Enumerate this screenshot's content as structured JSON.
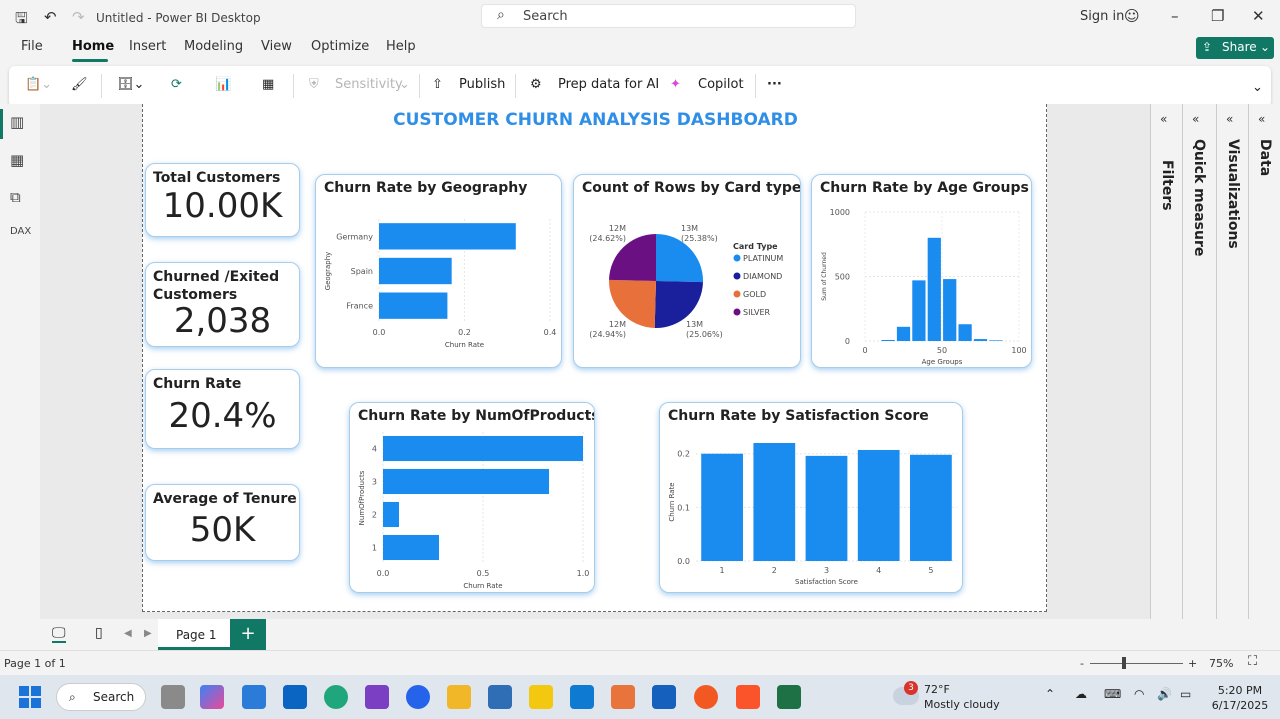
{
  "titlebar": {
    "title": "Untitled - Power BI Desktop",
    "search_placeholder": "Search",
    "signin": "Sign in"
  },
  "menu": {
    "items": [
      "File",
      "Home",
      "Insert",
      "Modeling",
      "View",
      "Optimize",
      "Help"
    ],
    "active": "Home",
    "share": "Share"
  },
  "ribbon": {
    "sensitivity": "Sensitivity",
    "publish": "Publish",
    "prep_ai": "Prep data for AI",
    "copilot": "Copilot",
    "more": "···"
  },
  "report": {
    "title": "CUSTOMER CHURN ANALYSIS DASHBOARD",
    "kpis": [
      {
        "label": "Total Customers",
        "value": "10.00K"
      },
      {
        "label": "Churned /Exited Customers",
        "value": "2,038"
      },
      {
        "label": "Churn Rate",
        "value": "20.4%"
      },
      {
        "label": "Average of Tenure",
        "value": "50K"
      }
    ]
  },
  "chart_data": [
    {
      "id": "geo",
      "type": "bar",
      "orientation": "horizontal",
      "title": "Churn Rate by Geography",
      "categories": [
        "Germany",
        "Spain",
        "France"
      ],
      "values": [
        0.32,
        0.17,
        0.16
      ],
      "xlabel": "Churn Rate",
      "ylabel": "Geography",
      "xlim": [
        0,
        0.4
      ],
      "xticks": [
        "0.0",
        "0.2",
        "0.4"
      ],
      "color": "#1a8cf0"
    },
    {
      "id": "card",
      "type": "pie",
      "title": "Count of Rows by Card type",
      "legend_title": "Card Type",
      "slices": [
        {
          "name": "PLATINUM",
          "value": 25.38,
          "label": "13M",
          "pct": "(25.38%)",
          "color": "#1a8cf0"
        },
        {
          "name": "DIAMOND",
          "value": 25.06,
          "label": "13M",
          "pct": "(25.06%)",
          "color": "#1a1f9c"
        },
        {
          "name": "GOLD",
          "value": 24.94,
          "label": "12M",
          "pct": "(24.94%)",
          "color": "#e8703a"
        },
        {
          "name": "SILVER",
          "value": 24.62,
          "label": "12M",
          "pct": "(24.62%)",
          "color": "#6b1082"
        }
      ],
      "legend_placement": "right"
    },
    {
      "id": "age",
      "type": "bar",
      "title": "Churn Rate by Age Groups",
      "x": [
        15,
        25,
        35,
        45,
        55,
        65,
        75,
        85
      ],
      "values": [
        8,
        110,
        470,
        800,
        480,
        130,
        15,
        5
      ],
      "xlabel": "Age Groups",
      "ylabel": "Sum of Churned",
      "xlim": [
        0,
        100
      ],
      "ylim": [
        0,
        1000
      ],
      "xticks": [
        "0",
        "50",
        "100"
      ],
      "yticks": [
        "0",
        "500",
        "1000"
      ],
      "color": "#1a8cf0"
    },
    {
      "id": "prod",
      "type": "bar",
      "orientation": "horizontal",
      "title": "Churn Rate by NumOfProducts",
      "categories": [
        "4",
        "3",
        "2",
        "1"
      ],
      "values": [
        1.0,
        0.83,
        0.08,
        0.28
      ],
      "xlabel": "Churn Rate",
      "ylabel": "NumOfProducts",
      "xlim": [
        0,
        1.0
      ],
      "xticks": [
        "0.0",
        "0.5",
        "1.0"
      ],
      "color": "#1a8cf0"
    },
    {
      "id": "sat",
      "type": "bar",
      "title": "Churn Rate by Satisfaction Score",
      "categories": [
        "1",
        "2",
        "3",
        "4",
        "5"
      ],
      "values": [
        0.2,
        0.22,
        0.196,
        0.207,
        0.198
      ],
      "xlabel": "Satisfaction Score",
      "ylabel": "Churn Rate",
      "ylim": [
        0,
        0.22
      ],
      "yticks": [
        "0.0",
        "0.1",
        "0.2"
      ],
      "color": "#1a8cf0"
    }
  ],
  "panes": [
    "Filters",
    "Quick measure",
    "Visualizations",
    "Data"
  ],
  "pages": {
    "tab": "Page 1",
    "add": "+"
  },
  "status": {
    "page": "Page 1 of 1",
    "zoom": "75%",
    "zoom_minus": "-",
    "zoom_plus": "+"
  },
  "taskbar": {
    "search": "Search",
    "weather_temp": "72°F",
    "weather_desc": "Mostly cloudy",
    "weather_badge": "3",
    "time": "5:20 PM",
    "date": "6/17/2025"
  },
  "colors": {
    "accent": "#117865",
    "chart": "#1a8cf0",
    "title_blue": "#2f8fe6"
  }
}
